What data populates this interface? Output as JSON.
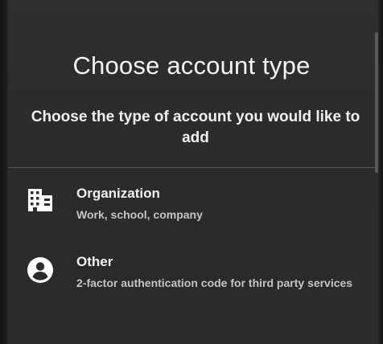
{
  "header": {
    "title": "Choose account type",
    "subtitle": "Choose the type of account you would like to add"
  },
  "options": [
    {
      "icon": "building-icon",
      "title": "Organization",
      "description": "Work, school, company"
    },
    {
      "icon": "person-circle-icon",
      "title": "Other",
      "description": "2-factor authentication code for third party services"
    }
  ],
  "colors": {
    "background": "#2c2c2c",
    "text": "#ffffff",
    "secondary_text": "#c4c4c4",
    "divider": "#575757"
  }
}
